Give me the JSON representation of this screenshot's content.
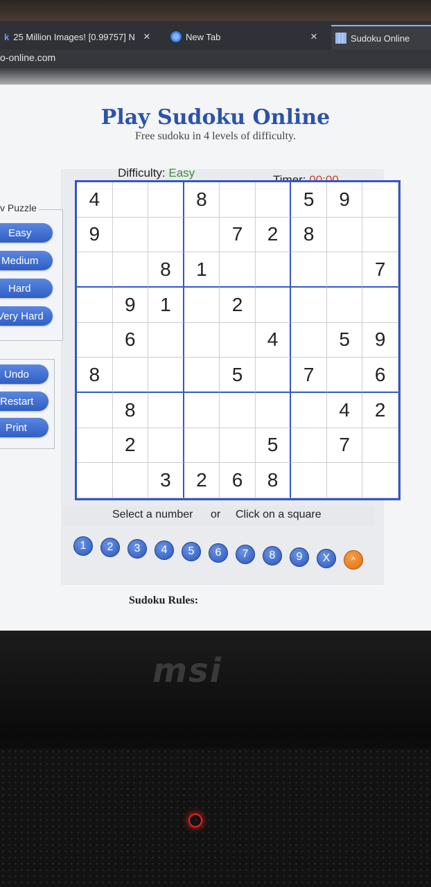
{
  "browser": {
    "tabs": [
      {
        "label": "25 Million Images! [0.99757] N",
        "close": "×"
      },
      {
        "label": "New Tab"
      },
      {
        "label": "Sudoku Online",
        "close": "×"
      }
    ],
    "address": "o-online.com"
  },
  "page": {
    "title": "Play Sudoku Online",
    "subtitle": "Free sudoku in 4 levels of difficulty.",
    "difficulty_label": "Difficulty:",
    "difficulty_value": "Easy",
    "timer_label": "Timer:",
    "timer_value": "00:00",
    "new_puzzle_label": "v Puzzle",
    "buttons": {
      "easy": "Easy",
      "medium": "Medium",
      "hard": "Hard",
      "very_hard": "Very Hard",
      "undo": "Undo",
      "restart": "Restart",
      "print": "Print"
    },
    "grid": [
      [
        "4",
        "",
        "",
        "8",
        "",
        "",
        "5",
        "9",
        ""
      ],
      [
        "9",
        "",
        "",
        "",
        "7",
        "2",
        "8",
        "",
        ""
      ],
      [
        "",
        "",
        "8",
        "1",
        "",
        "",
        "",
        "",
        "7"
      ],
      [
        "",
        "9",
        "1",
        "",
        "2",
        "",
        "",
        "",
        ""
      ],
      [
        "",
        "6",
        "",
        "",
        "",
        "4",
        "",
        "5",
        "9"
      ],
      [
        "8",
        "",
        "",
        "",
        "5",
        "",
        "7",
        "",
        "6"
      ],
      [
        "",
        "8",
        "",
        "",
        "",
        "",
        "",
        "4",
        "2"
      ],
      [
        "",
        "2",
        "",
        "",
        "",
        "5",
        "",
        "7",
        ""
      ],
      [
        "",
        "",
        "3",
        "2",
        "6",
        "8",
        "",
        "",
        ""
      ]
    ],
    "select_text": "Select a number",
    "or_text": "or",
    "click_text": "Click on a square",
    "number_buttons": [
      "1",
      "2",
      "3",
      "4",
      "5",
      "6",
      "7",
      "8",
      "9",
      "X",
      "^"
    ],
    "rules_heading": "Sudoku Rules:"
  },
  "device": {
    "brand": "msi"
  }
}
